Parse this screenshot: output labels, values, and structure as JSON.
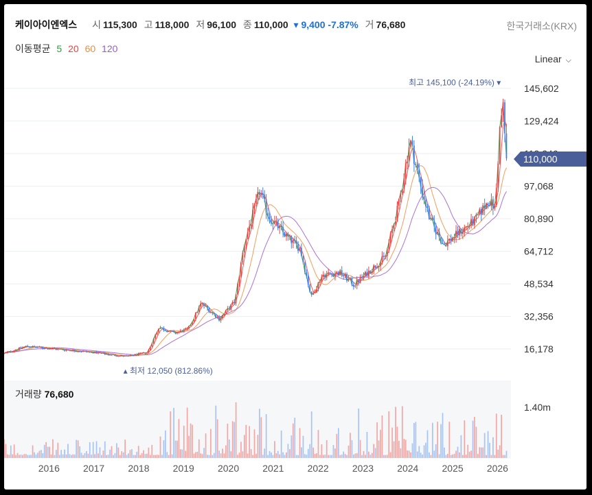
{
  "header": {
    "name": "케이아이엔엑스",
    "open_label": "시",
    "open": "115,300",
    "high_label": "고",
    "high": "118,000",
    "low_label": "저",
    "low": "96,100",
    "close_label": "종",
    "close": "110,000",
    "change": "▾ 9,400 -7.87%",
    "volume_label": "거",
    "volume": "76,680",
    "exchange": "한국거래소(KRX)"
  },
  "moving_average": {
    "label": "이동평균",
    "periods": [
      {
        "value": "5",
        "color": "#2e9a3f"
      },
      {
        "value": "20",
        "color": "#e8423f"
      },
      {
        "value": "60",
        "color": "#f08c3c"
      },
      {
        "value": "120",
        "color": "#9b59d0"
      }
    ]
  },
  "scale_selector": {
    "label": "Linear"
  },
  "current_price_tag": "110,000",
  "volume_panel": {
    "label": "거래량",
    "value": "76,680"
  },
  "colors": {
    "up": "#e8423f",
    "down": "#3d7ee6",
    "up_vol": "#f2a7a5",
    "down_vol": "#a7c4f2",
    "accent": "#4a5f9a"
  },
  "chart_data": {
    "type": "candlestick",
    "y_ticks": [
      "145,602",
      "129,424",
      "113,246",
      "97,068",
      "80,890",
      "64,712",
      "48,534",
      "32,356",
      "16,178"
    ],
    "y_tick_values": [
      145602,
      129424,
      113246,
      97068,
      80890,
      64712,
      48534,
      32356,
      16178
    ],
    "ylim": [
      7000,
      150000
    ],
    "x_ticks": [
      "2016",
      "2017",
      "2018",
      "2019",
      "2020",
      "2021",
      "2022",
      "2023",
      "2024",
      "2025",
      "2026"
    ],
    "x_tick_years": [
      2016,
      2017,
      2018,
      2019,
      2020,
      2021,
      2022,
      2023,
      2024,
      2025,
      2026
    ],
    "x_range_years": [
      2015.0,
      2026.3
    ],
    "volume_tick": "1.40m",
    "volume_tick_value": 1400000,
    "max_annotation": {
      "text": "최고 145,100 (-24.19%)",
      "value": 145100,
      "year": 2026.12
    },
    "min_annotation": {
      "text": "최저 12,050 (812.86%)",
      "value": 12050,
      "year": 2017.75
    },
    "price_path": [
      {
        "year": 2015.0,
        "price": 14000
      },
      {
        "year": 2015.5,
        "price": 17500
      },
      {
        "year": 2016.0,
        "price": 16500
      },
      {
        "year": 2016.5,
        "price": 15500
      },
      {
        "year": 2017.0,
        "price": 14500
      },
      {
        "year": 2017.5,
        "price": 13000
      },
      {
        "year": 2017.75,
        "price": 12500
      },
      {
        "year": 2018.2,
        "price": 14500
      },
      {
        "year": 2018.45,
        "price": 27000
      },
      {
        "year": 2018.8,
        "price": 24000
      },
      {
        "year": 2019.1,
        "price": 26000
      },
      {
        "year": 2019.4,
        "price": 39000
      },
      {
        "year": 2019.8,
        "price": 31000
      },
      {
        "year": 2020.15,
        "price": 40000
      },
      {
        "year": 2020.35,
        "price": 68000
      },
      {
        "year": 2020.7,
        "price": 95000
      },
      {
        "year": 2020.9,
        "price": 82000
      },
      {
        "year": 2021.3,
        "price": 72000
      },
      {
        "year": 2021.6,
        "price": 66000
      },
      {
        "year": 2021.85,
        "price": 42000
      },
      {
        "year": 2022.1,
        "price": 53000
      },
      {
        "year": 2022.5,
        "price": 54000
      },
      {
        "year": 2022.8,
        "price": 48000
      },
      {
        "year": 2023.2,
        "price": 56000
      },
      {
        "year": 2023.5,
        "price": 62000
      },
      {
        "year": 2023.8,
        "price": 88000
      },
      {
        "year": 2024.05,
        "price": 120000
      },
      {
        "year": 2024.3,
        "price": 96000
      },
      {
        "year": 2024.5,
        "price": 80000
      },
      {
        "year": 2024.8,
        "price": 68000
      },
      {
        "year": 2025.2,
        "price": 75000
      },
      {
        "year": 2025.5,
        "price": 80000
      },
      {
        "year": 2025.8,
        "price": 90000
      },
      {
        "year": 2025.95,
        "price": 86000
      },
      {
        "year": 2026.05,
        "price": 125000
      },
      {
        "year": 2026.12,
        "price": 138000
      },
      {
        "year": 2026.2,
        "price": 110000
      }
    ]
  }
}
